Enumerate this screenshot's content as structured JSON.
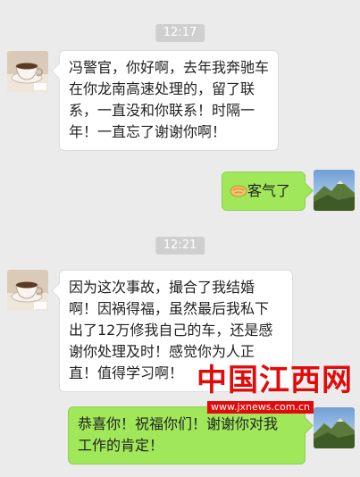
{
  "chat": {
    "timestamps": [
      "12:17",
      "12:21"
    ],
    "messages": [
      {
        "direction": "incoming",
        "avatar": "teacup-icon",
        "text": "冯警官，你好啊，去年我奔驰车\n在你龙南高速处理的，留了联\n系，一直没和你联系！时隔一\n年！一直忘了谢谢你啊！"
      },
      {
        "direction": "outgoing",
        "avatar": "mountain-landscape-icon",
        "emoji": "handshake-emoji",
        "text": "客气了"
      },
      {
        "direction": "incoming",
        "avatar": "teacup-icon",
        "text": "因为这次事故，撮合了我结婚\n啊！因祸得福，虽然最后我私下\n出了12万修我自己的车，还是感\n谢你处理及时！感觉你为人正\n直！值得学习啊！"
      },
      {
        "direction": "outgoing",
        "avatar": "mountain-landscape-icon",
        "text": "恭喜你！祝福你们！谢谢你对我\n工作的肯定！"
      }
    ]
  },
  "watermark": {
    "logo_text": "中国江西网",
    "url": "www.jxnews.com.cn"
  },
  "colors": {
    "background": "#ebebeb",
    "incoming_bubble": "#ffffff",
    "outgoing_bubble": "#a0e75a",
    "time_pill": "#cfcfcf",
    "watermark_red": "#e20b0b"
  }
}
